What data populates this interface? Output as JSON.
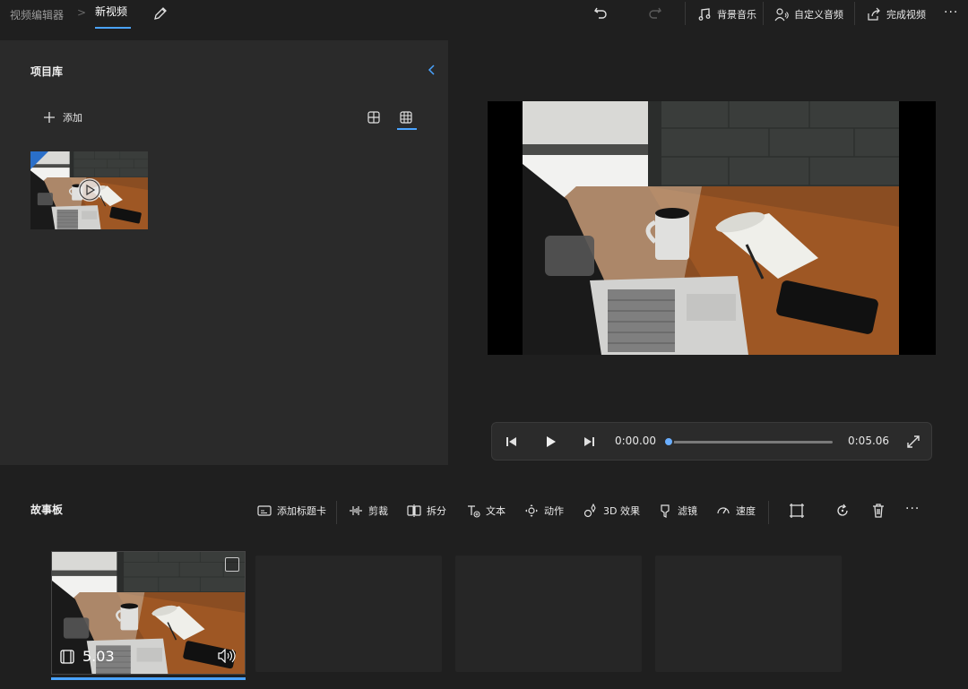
{
  "header": {
    "app_name": "视频编辑器",
    "separator": ">",
    "project_name": "新视频",
    "buttons": {
      "background_music": "背景音乐",
      "custom_audio": "自定义音频",
      "finish_video": "完成视频"
    },
    "more": "···"
  },
  "library": {
    "title": "项目库",
    "add_label": "添加"
  },
  "player": {
    "current_time": "0:00.00",
    "total_time": "0:05.06",
    "progress": 0
  },
  "storyboard": {
    "title": "故事板",
    "tools": {
      "title_card": "添加标题卡",
      "trim": "剪裁",
      "split": "拆分",
      "text": "文本",
      "motion": "动作",
      "effects_3d": "3D 效果",
      "filters": "滤镜",
      "speed": "速度"
    },
    "more": "···",
    "clips": [
      {
        "duration": "5.03"
      }
    ]
  },
  "colors": {
    "accent": "#4aa3ff",
    "panel": "#2a2a2a",
    "background": "#1f1f1f"
  }
}
